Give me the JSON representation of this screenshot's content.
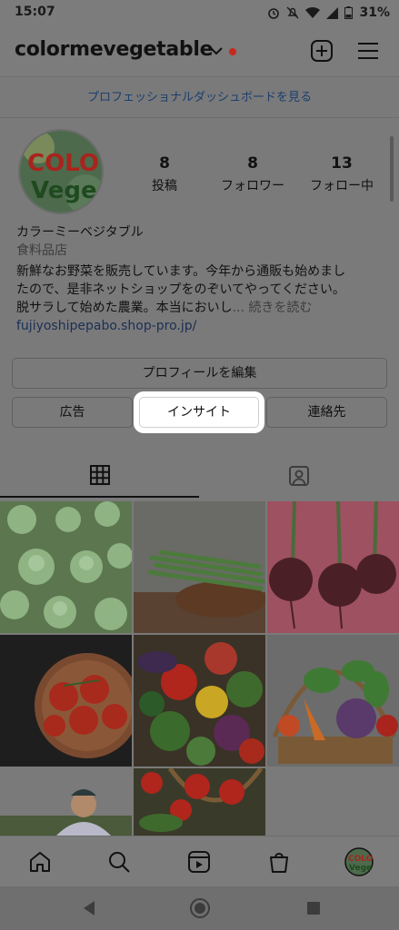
{
  "status_bar": {
    "time": "15:07",
    "battery": "31%"
  },
  "header": {
    "username": "colormevegetable",
    "icons": [
      "chevron-down-icon",
      "notification-dot",
      "add-post-icon",
      "menu-icon"
    ]
  },
  "dashboard_link": "プロフェッショナルダッシュボードを見る",
  "profile": {
    "avatar_text_top": "COLO",
    "avatar_text_bottom": "Vege",
    "stats": [
      {
        "value": "8",
        "label": "投稿"
      },
      {
        "value": "8",
        "label": "フォロワー"
      },
      {
        "value": "13",
        "label": "フォロー中"
      }
    ],
    "display_name": "カラーミーベジタブル",
    "category": "食料品店",
    "bio_lines": [
      "新鮮なお野菜を販売しています。今年から通販も始めまし",
      "たので、是非ネットショップをのぞいてやってください。",
      "脱サラして始めた農業。本当においし"
    ],
    "more": "... 続きを読む",
    "website": "fujiyoshipepabo.shop-pro.jp/"
  },
  "buttons": {
    "edit_profile": "プロフィールを編集",
    "ads": "広告",
    "insights": "インサイト",
    "contact": "連絡先"
  },
  "tabs": [
    "grid-icon",
    "tagged-icon"
  ],
  "grid_posts": [
    "broccoli-on-green",
    "asparagus-bowl",
    "beets-on-pink",
    "tomatoes-in-bowl",
    "mixed-vegetables",
    "vegetable-basket",
    "farmer-portrait",
    "tomato-basket"
  ],
  "bottom_nav": [
    "home-icon",
    "search-icon",
    "reels-icon",
    "shop-icon",
    "profile-avatar"
  ],
  "system_nav": [
    "back-icon",
    "home-circle-icon",
    "recents-icon"
  ]
}
